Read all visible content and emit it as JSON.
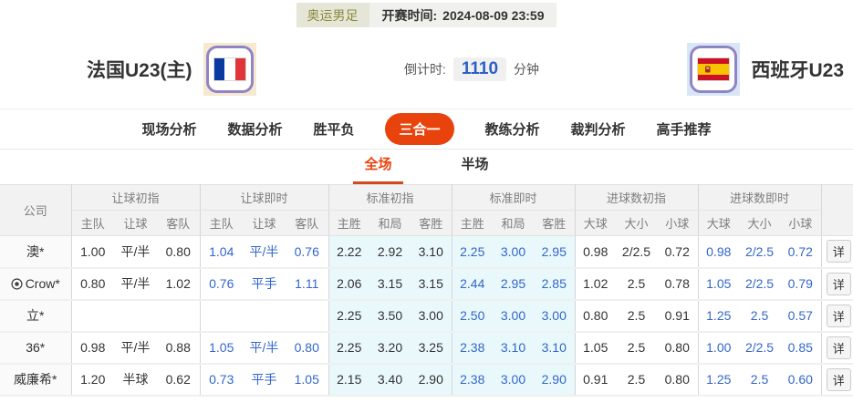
{
  "top_bar": {
    "league_badge": "奥运男足",
    "kickoff_label": "开赛时间:",
    "kickoff_time": "2024-08-09 23:59"
  },
  "match_header": {
    "home_team": "法国U23(主)",
    "away_team": "西班牙U23",
    "home_flag": "france-flag",
    "away_flag": "spain-flag",
    "countdown_label": "倒计时:",
    "countdown_value": "1110",
    "countdown_unit": "分钟"
  },
  "nav_tabs": [
    {
      "label": "现场分析",
      "active": false
    },
    {
      "label": "数据分析",
      "active": false
    },
    {
      "label": "胜平负",
      "active": false
    },
    {
      "label": "三合一",
      "active": true
    },
    {
      "label": "教练分析",
      "active": false
    },
    {
      "label": "裁判分析",
      "active": false
    },
    {
      "label": "高手推荐",
      "active": false
    }
  ],
  "sub_tabs": [
    {
      "label": "全场",
      "active": true
    },
    {
      "label": "半场",
      "active": false
    }
  ],
  "table": {
    "company_header": "公司",
    "detail_label": "详",
    "groups": [
      {
        "label": "让球初指",
        "cols": [
          "主队",
          "让球",
          "客队"
        ],
        "live": false,
        "tinted": false
      },
      {
        "label": "让球即时",
        "cols": [
          "主队",
          "让球",
          "客队"
        ],
        "live": true,
        "tinted": false
      },
      {
        "label": "标准初指",
        "cols": [
          "主胜",
          "和局",
          "客胜"
        ],
        "live": false,
        "tinted": true
      },
      {
        "label": "标准即时",
        "cols": [
          "主胜",
          "和局",
          "客胜"
        ],
        "live": true,
        "tinted": true
      },
      {
        "label": "进球数初指",
        "cols": [
          "大球",
          "大小",
          "小球"
        ],
        "live": false,
        "tinted": false
      },
      {
        "label": "进球数即时",
        "cols": [
          "大球",
          "大小",
          "小球"
        ],
        "live": true,
        "tinted": false
      }
    ],
    "rows": [
      {
        "company": "澳*",
        "ball_icon": false,
        "groups": [
          [
            "1.00",
            "平/半",
            "0.80"
          ],
          [
            "1.04",
            "平/半",
            "0.76"
          ],
          [
            "2.22",
            "2.92",
            "3.10"
          ],
          [
            "2.25",
            "3.00",
            "2.95"
          ],
          [
            "0.98",
            "2/2.5",
            "0.72"
          ],
          [
            "0.98",
            "2/2.5",
            "0.72"
          ]
        ]
      },
      {
        "company": "Crow*",
        "ball_icon": true,
        "groups": [
          [
            "0.80",
            "平/半",
            "1.02"
          ],
          [
            "0.76",
            "平手",
            "1.11"
          ],
          [
            "2.06",
            "3.15",
            "3.15"
          ],
          [
            "2.44",
            "2.95",
            "2.85"
          ],
          [
            "1.02",
            "2.5",
            "0.78"
          ],
          [
            "1.05",
            "2/2.5",
            "0.79"
          ]
        ]
      },
      {
        "company": "立*",
        "ball_icon": false,
        "groups": [
          [
            "",
            "",
            ""
          ],
          [
            "",
            "",
            ""
          ],
          [
            "2.25",
            "3.50",
            "3.00"
          ],
          [
            "2.50",
            "3.00",
            "3.00"
          ],
          [
            "0.80",
            "2.5",
            "0.91"
          ],
          [
            "1.25",
            "2.5",
            "0.57"
          ]
        ]
      },
      {
        "company": "36*",
        "ball_icon": false,
        "groups": [
          [
            "0.98",
            "平/半",
            "0.88"
          ],
          [
            "1.05",
            "平/半",
            "0.80"
          ],
          [
            "2.25",
            "3.20",
            "3.25"
          ],
          [
            "2.38",
            "3.10",
            "3.10"
          ],
          [
            "1.05",
            "2.5",
            "0.80"
          ],
          [
            "1.00",
            "2/2.5",
            "0.85"
          ]
        ]
      },
      {
        "company": "威廉希*",
        "ball_icon": false,
        "groups": [
          [
            "1.20",
            "半球",
            "0.62"
          ],
          [
            "0.73",
            "平手",
            "1.05"
          ],
          [
            "2.15",
            "3.40",
            "2.90"
          ],
          [
            "2.38",
            "3.00",
            "2.90"
          ],
          [
            "0.91",
            "2.5",
            "0.80"
          ],
          [
            "1.25",
            "2.5",
            "0.60"
          ]
        ]
      }
    ]
  },
  "colors": {
    "accent": "#e8430d",
    "live_blue": "#3366cc",
    "standard_tint": "#e9f8fb",
    "countdown_blue": "#2b5fc7"
  }
}
